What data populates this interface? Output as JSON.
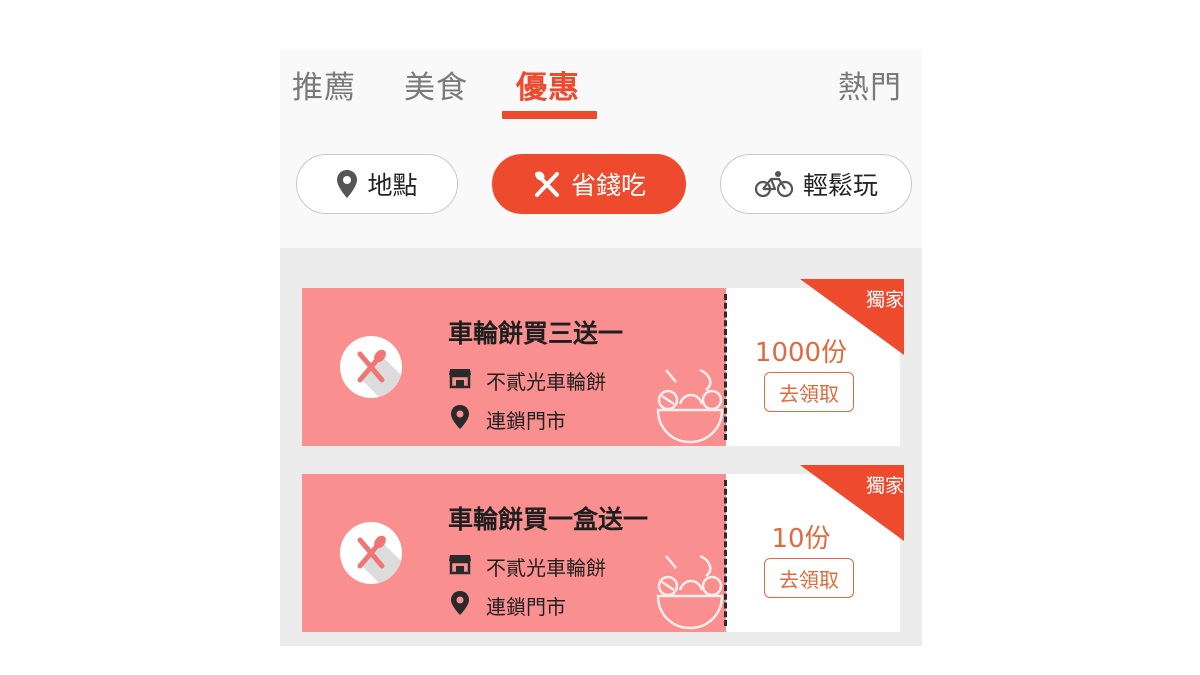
{
  "tabs": [
    {
      "label": "推薦",
      "active": false
    },
    {
      "label": "美食",
      "active": false
    },
    {
      "label": "優惠",
      "active": true
    },
    {
      "label": "熱門",
      "active": false
    }
  ],
  "chips": [
    {
      "label": "地點",
      "icon": "map-pin-icon",
      "active": false
    },
    {
      "label": "省錢吃",
      "icon": "fork-knife-icon",
      "active": true
    },
    {
      "label": "輕鬆玩",
      "icon": "bicycle-icon",
      "active": false
    }
  ],
  "coupons": [
    {
      "title": "車輪餅買三送一",
      "store": "不貳光車輪餅",
      "location": "連鎖門市",
      "quantity": "1000份",
      "claim_label": "去領取",
      "badge": "獨家"
    },
    {
      "title": "車輪餅買一盒送一",
      "store": "不貳光車輪餅",
      "location": "連鎖門市",
      "quantity": "10份",
      "claim_label": "去領取",
      "badge": "獨家"
    }
  ],
  "colors": {
    "accent": "#ee4a2e",
    "coupon_bg": "#fa8f8f",
    "claim_text": "#e16a3e"
  }
}
